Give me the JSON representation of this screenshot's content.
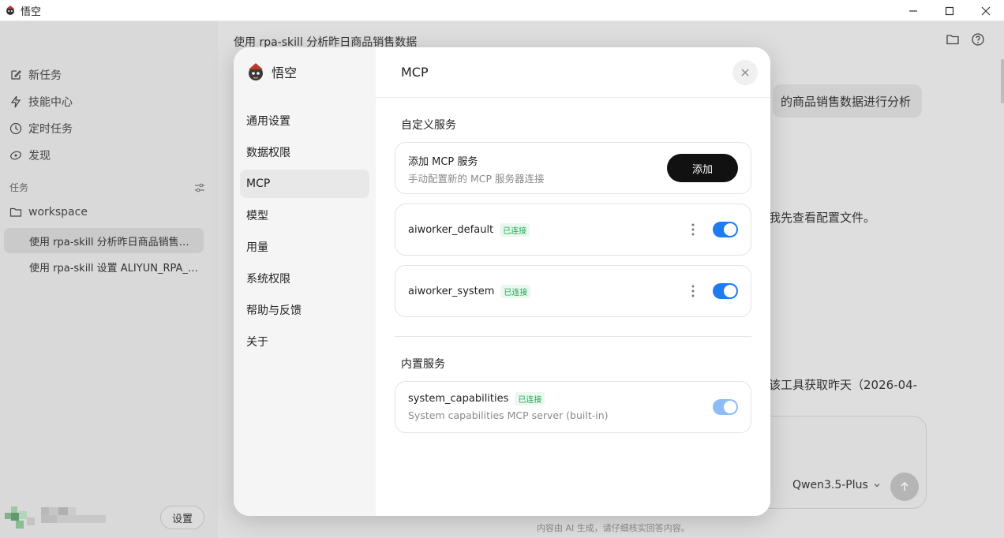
{
  "window": {
    "title": "悟空",
    "controls": {
      "minimize": "—",
      "maximize": "☐",
      "close": "✕"
    }
  },
  "sidebar": {
    "nav": [
      {
        "label": "新任务",
        "icon": "edit-icon"
      },
      {
        "label": "技能中心",
        "icon": "lightning-icon"
      },
      {
        "label": "定时任务",
        "icon": "clock-icon"
      },
      {
        "label": "发现",
        "icon": "discover-icon"
      }
    ],
    "section_label": "任务",
    "workspace_label": "workspace",
    "tasks": [
      "使用 rpa-skill 分析昨日商品销售…",
      "使用 rpa-skill 设置 ALIYUN_RPA_…"
    ],
    "settings_label": "设置"
  },
  "main": {
    "title": "使用 rpa-skill 分析昨日商品销售数据",
    "bubble_text": "的商品销售数据进行分析",
    "line1": "我先查看配置文件。",
    "line2": "该工具获取昨天（2026-04-",
    "model": "Qwen3.5-Plus",
    "disclaimer": "内容由 AI 生成，请仔细核实回答内容。"
  },
  "modal": {
    "brand_name": "悟空",
    "menu": [
      {
        "label": "通用设置",
        "active": false
      },
      {
        "label": "数据权限",
        "active": false
      },
      {
        "label": "MCP",
        "active": true
      },
      {
        "label": "模型",
        "active": false
      },
      {
        "label": "用量",
        "active": false
      },
      {
        "label": "系统权限",
        "active": false
      },
      {
        "label": "帮助与反馈",
        "active": false
      },
      {
        "label": "关于",
        "active": false
      }
    ],
    "panel_title": "MCP",
    "custom_label": "自定义服务",
    "add_card": {
      "title": "添加 MCP 服务",
      "desc": "手动配置新的 MCP 服务器连接",
      "button": "添加"
    },
    "servers": [
      {
        "name": "aiworker_default",
        "status": "已连接",
        "enabled": true
      },
      {
        "name": "aiworker_system",
        "status": "已连接",
        "enabled": true
      }
    ],
    "builtin_label": "内置服务",
    "builtin": {
      "name": "system_capabilities",
      "status": "已连接",
      "desc": "System capabilities MCP server (built-in)",
      "enabled": true
    }
  },
  "colors": {
    "toggle_on": "#1e7bf0",
    "toggle_disabled": "#8cbdf7",
    "status_green": "#1fa855",
    "add_button": "#111111"
  }
}
